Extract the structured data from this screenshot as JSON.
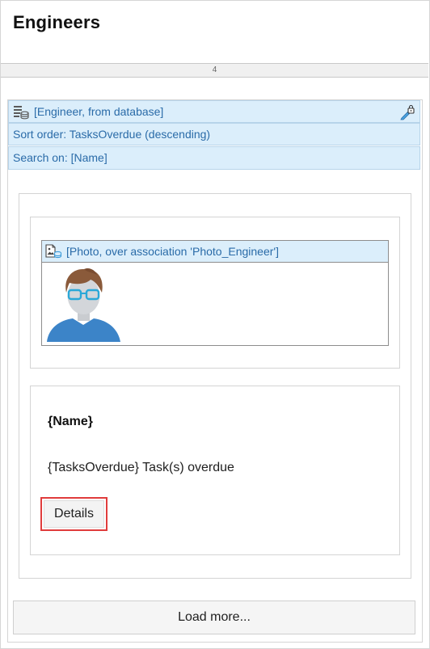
{
  "page": {
    "title": "Engineers"
  },
  "layout_grid": {
    "column_label": "4"
  },
  "list_view": {
    "source": "[Engineer, from database]",
    "sort_order": "Sort order: TasksOverdue (descending)",
    "search_on": "Search on: [Name]"
  },
  "image_widget": {
    "label": "[Photo, over association 'Photo_Engineer']",
    "icon": "image-database-icon",
    "placeholder_icon": "avatar-placeholder"
  },
  "card": {
    "name": "{Name}",
    "tasks_text": "{TasksOverdue} Task(s) overdue",
    "details_label": "Details"
  },
  "footer": {
    "load_more_label": "Load more..."
  },
  "colors": {
    "accent_blue": "#2a6ba8",
    "header_fill": "#dbeefb",
    "highlight_red": "#e03c3c"
  }
}
